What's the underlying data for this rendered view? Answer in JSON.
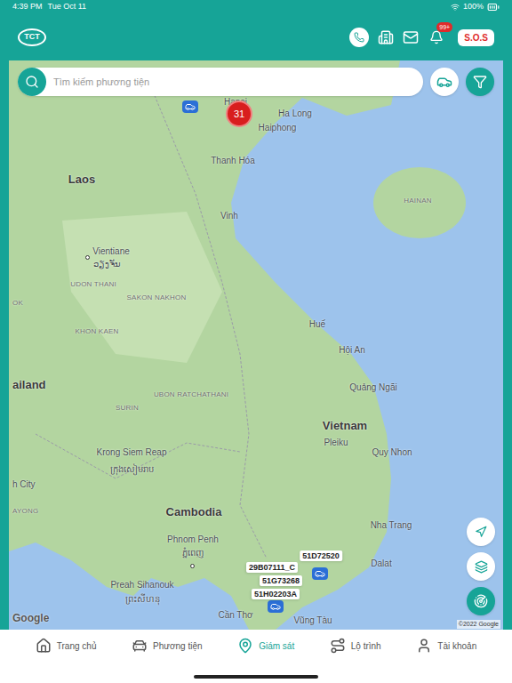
{
  "status_bar": {
    "time": "4:39 PM",
    "date": "Tue Oct 11",
    "battery": "100%"
  },
  "header": {
    "logo": "TCT",
    "notification_badge": "99+",
    "sos": "S.O.S"
  },
  "search": {
    "placeholder": "Tìm kiếm phương tiện"
  },
  "map": {
    "cluster": "31",
    "labels": [
      {
        "text": "Hanoi",
        "kind": "city"
      },
      {
        "text": "Haiphong",
        "kind": "city"
      },
      {
        "text": "Ha Long",
        "kind": "city"
      },
      {
        "text": "Laos",
        "kind": "country"
      },
      {
        "text": "Thanh Hóa",
        "kind": "city"
      },
      {
        "text": "Vinh",
        "kind": "city"
      },
      {
        "text": "HAINAN",
        "kind": "region"
      },
      {
        "text": "Vientiane",
        "kind": "city"
      },
      {
        "text": "ວຽງຈັນ",
        "kind": "city"
      },
      {
        "text": "UDON THANI",
        "kind": "region"
      },
      {
        "text": "SAKON NAKHON",
        "kind": "region"
      },
      {
        "text": "OK",
        "kind": "edge-region"
      },
      {
        "text": "KHON KAEN",
        "kind": "region"
      },
      {
        "text": "Huế",
        "kind": "city"
      },
      {
        "text": "Hội An",
        "kind": "city"
      },
      {
        "text": "Quảng Ngãi",
        "kind": "city"
      },
      {
        "text": "ailand",
        "kind": "edge-country"
      },
      {
        "text": "UBON RATCHATHANI",
        "kind": "region"
      },
      {
        "text": "SURIN",
        "kind": "region"
      },
      {
        "text": "Vietnam",
        "kind": "country"
      },
      {
        "text": "Pleiku",
        "kind": "city"
      },
      {
        "text": "Quy Nhon",
        "kind": "city"
      },
      {
        "text": "Krong Siem Reap",
        "kind": "city"
      },
      {
        "text": "ក្រុងសៀមរាប",
        "kind": "city"
      },
      {
        "text": "h City",
        "kind": "edge-city"
      },
      {
        "text": "AYONG",
        "kind": "edge-region"
      },
      {
        "text": "Cambodia",
        "kind": "country"
      },
      {
        "text": "Nha Trang",
        "kind": "city"
      },
      {
        "text": "Phnom Penh",
        "kind": "city"
      },
      {
        "text": "ភ្នំពេញ",
        "kind": "city"
      },
      {
        "text": "Dalat",
        "kind": "city"
      },
      {
        "text": "Preah Sihanouk",
        "kind": "city"
      },
      {
        "text": "ព្រះសីហនុ",
        "kind": "city"
      },
      {
        "text": "Vũng Tàu",
        "kind": "city"
      },
      {
        "text": "Cần Thơ",
        "kind": "city"
      }
    ],
    "vehicles": [
      {
        "plate": "51D72520"
      },
      {
        "plate": "29B07111_C"
      },
      {
        "plate": "51G73268"
      },
      {
        "plate": "51H02203A"
      }
    ],
    "attribution": {
      "logo": "Google",
      "copyright": "©2022 Google"
    }
  },
  "nav": [
    {
      "label": "Trang chủ",
      "selected": false
    },
    {
      "label": "Phương tiện",
      "selected": false
    },
    {
      "label": "Giám sát",
      "selected": true
    },
    {
      "label": "Lộ trình",
      "selected": false
    },
    {
      "label": "Tài khoản",
      "selected": false
    }
  ]
}
